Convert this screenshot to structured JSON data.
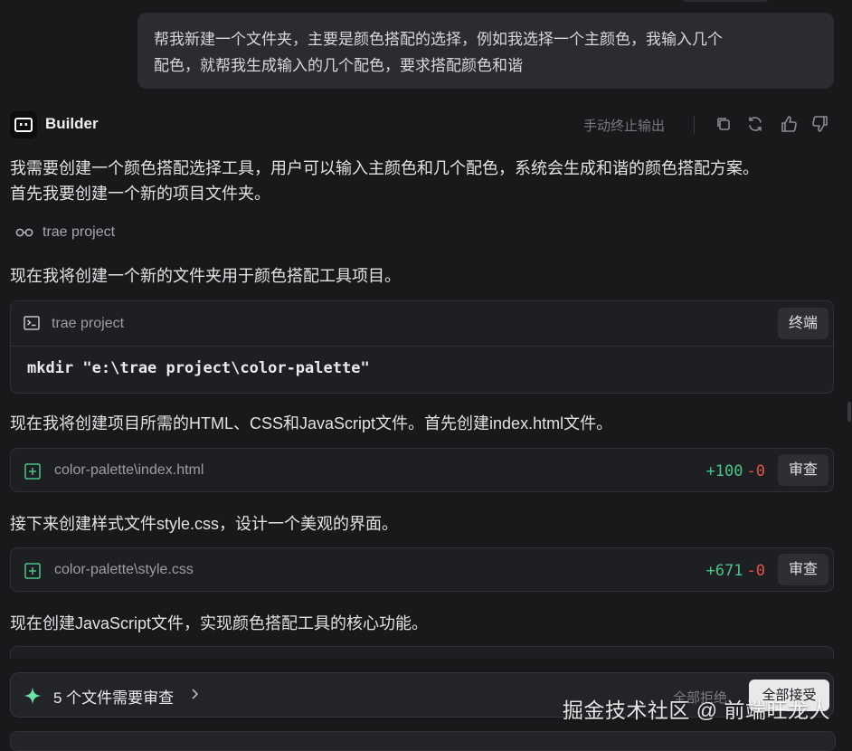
{
  "user_message": {
    "line1": "帮我新建一个文件夹，主要是颜色搭配的选择，例如我选择一个主颜色，我输入几个",
    "line2": "配色，就帮我生成输入的几个配色，要求搭配颜色和谐"
  },
  "assistant": {
    "name": "Builder",
    "stop_output_label": "手动终止输出",
    "header_icons": [
      "copy-icon",
      "refresh-icon",
      "thumbs-up-icon",
      "thumbs-down-icon"
    ]
  },
  "messages": {
    "intro_line1": "我需要创建一个颜色搭配选择工具，用户可以输入主颜色和几个配色，系统会生成和谐的颜色搭配方案。",
    "intro_line2": "首先我要创建一个新的项目文件夹。",
    "context_ref": "trae project",
    "create_folder": "现在我将创建一个新的文件夹用于颜色搭配工具项目。",
    "create_html": "现在我将创建项目所需的HTML、CSS和JavaScript文件。首先创建index.html文件。",
    "create_css": "接下来创建样式文件style.css，设计一个美观的界面。",
    "create_js": "现在创建JavaScript文件，实现颜色搭配工具的核心功能。"
  },
  "terminal": {
    "title": "trae project",
    "button_label": "终端",
    "command": "mkdir \"e:\\trae project\\color-palette\""
  },
  "files": [
    {
      "path": "color-palette\\index.html",
      "added": "+100",
      "removed": "-0",
      "review_label": "审查"
    },
    {
      "path": "color-palette\\style.css",
      "added": "+671",
      "removed": "-0",
      "review_label": "审查"
    }
  ],
  "review_bar": {
    "title": "5 个文件需要审查",
    "reject_all": "全部拒绝",
    "accept_all": "全部接受"
  },
  "watermark": "掘金技术社区 @ 前端旺龙人",
  "colors": {
    "background": "#19191b",
    "card": "#1e1f22",
    "added": "#4cc38a",
    "removed": "#e5534b",
    "accept_button": "#e9e9ec"
  }
}
